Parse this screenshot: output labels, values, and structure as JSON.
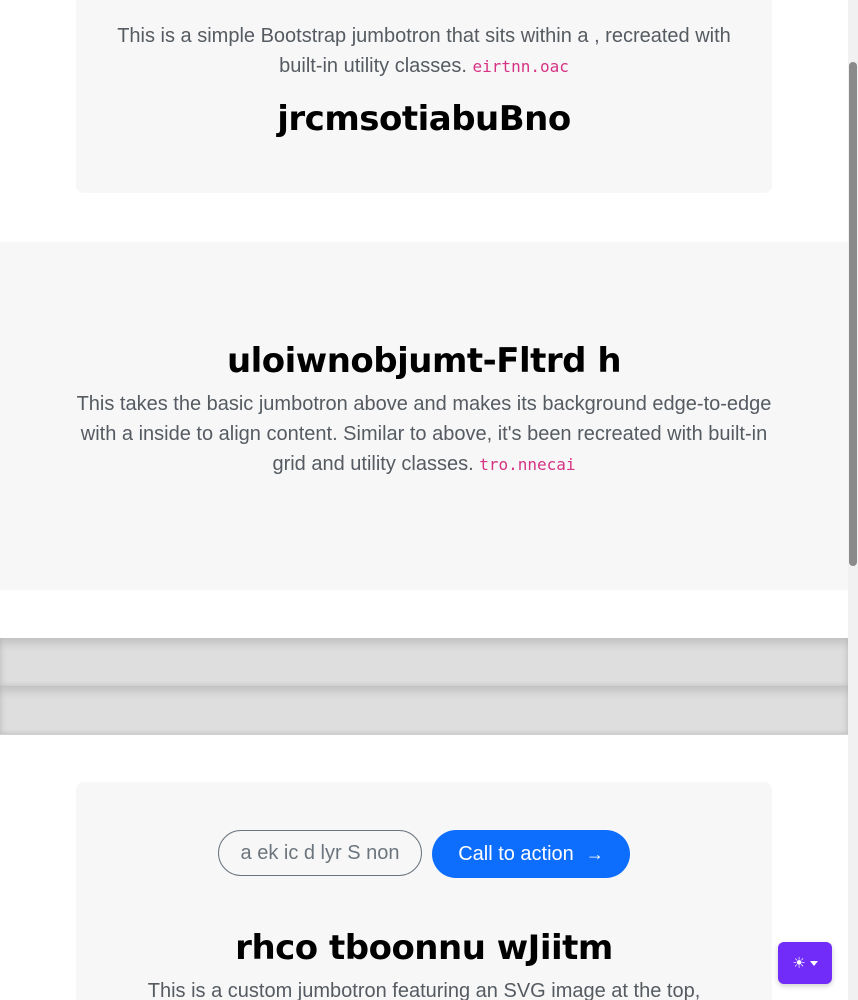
{
  "jumbotron_1": {
    "lead": "This is a simple Bootstrap jumbotron that sits within a , recreated with built-in utility classes.",
    "code": "eirtnn.oac",
    "title": "jrcmsotiabuBno"
  },
  "jumbotron_full": {
    "title": "uloiwnobjumt-Fltrd h",
    "lead": "This takes the basic jumbotron above and makes its background edge-to-edge with a inside to align content. Similar to above, it's been recreated with built-in grid and utility classes.",
    "code": "tro.nnecai"
  },
  "jumbotron_3": {
    "secondary_button": "a ek ic d lyr S non",
    "primary_button": "Call to action",
    "primary_button_icon": "arrow-right-icon",
    "title": "rhco tboonnu wJiitm",
    "lead": "This is a custom jumbotron featuring an SVG image at the top,"
  },
  "theme_toggle": {
    "icon": "sun-icon",
    "accent_color": "#712cf9"
  },
  "colors": {
    "primary": "#0d6efd",
    "code": "#d63384",
    "jumbotron_bg": "#f7f7f8"
  }
}
